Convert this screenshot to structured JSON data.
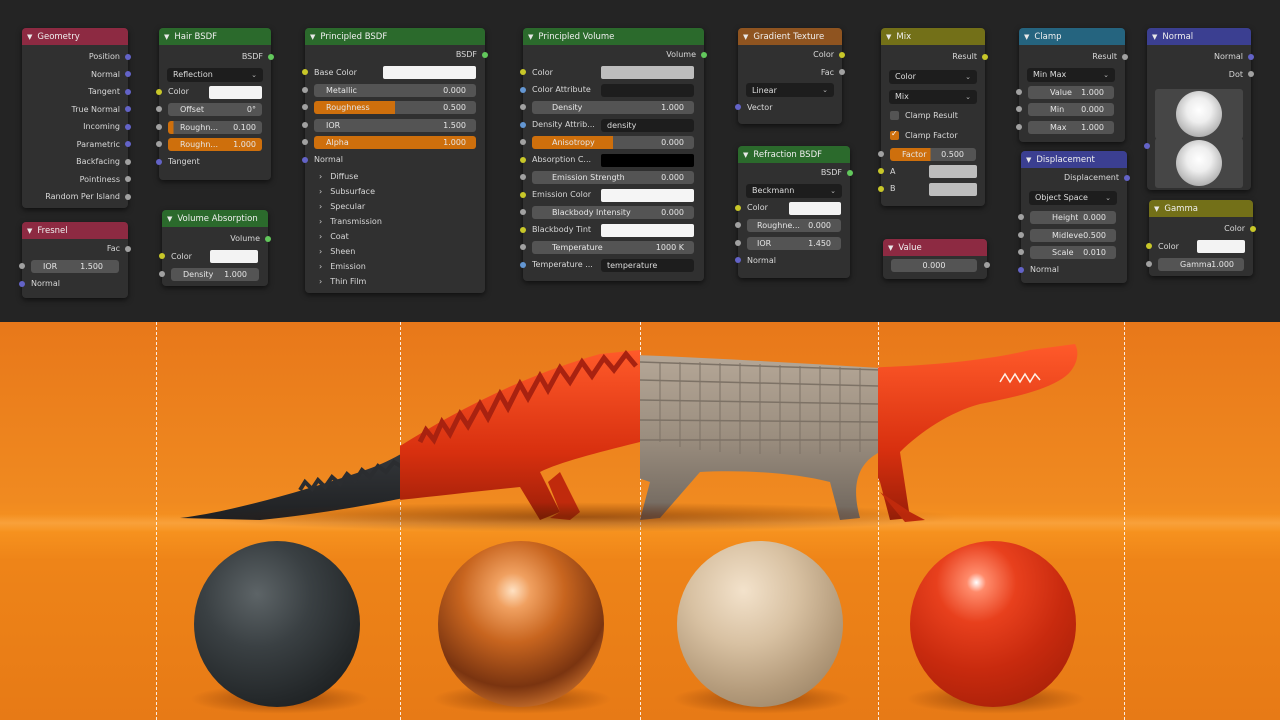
{
  "nodes": {
    "geometry": {
      "title": "Geometry",
      "outputs": [
        "Position",
        "Normal",
        "Tangent",
        "True Normal",
        "Incoming",
        "Parametric",
        "Backfacing",
        "Pointiness",
        "Random Per Island"
      ]
    },
    "fresnel": {
      "title": "Fresnel",
      "out": "Fac",
      "ior_label": "IOR",
      "ior_value": "1.500",
      "normal": "Normal"
    },
    "hair_bsdf": {
      "title": "Hair BSDF",
      "out": "BSDF",
      "dropdown": "Reflection",
      "color": "Color",
      "offset_label": "Offset",
      "offset_value": "0°",
      "rough1_label": "Roughn...",
      "rough1_value": "0.100",
      "rough2_label": "Roughn...",
      "rough2_value": "1.000",
      "tangent": "Tangent"
    },
    "volume_absorption": {
      "title": "Volume Absorption",
      "out": "Volume",
      "color": "Color",
      "density_label": "Density",
      "density_value": "1.000"
    },
    "principled_bsdf": {
      "title": "Principled BSDF",
      "out": "BSDF",
      "base_color": "Base Color",
      "metallic_label": "Metallic",
      "metallic_value": "0.000",
      "roughness_label": "Roughness",
      "roughness_value": "0.500",
      "ior_label": "IOR",
      "ior_value": "1.500",
      "alpha_label": "Alpha",
      "alpha_value": "1.000",
      "normal": "Normal",
      "panels": [
        "Diffuse",
        "Subsurface",
        "Specular",
        "Transmission",
        "Coat",
        "Sheen",
        "Emission",
        "Thin Film"
      ]
    },
    "principled_volume": {
      "title": "Principled Volume",
      "out": "Volume",
      "color": "Color",
      "color_attribute": "Color Attribute",
      "density_label": "Density",
      "density_value": "1.000",
      "density_attrib_label": "Density Attrib...",
      "density_attrib_value": "density",
      "anisotropy_label": "Anisotropy",
      "anisotropy_value": "0.000",
      "absorption_label": "Absorption C...",
      "emission_strength_label": "Emission Strength",
      "emission_strength_value": "0.000",
      "emission_color_label": "Emission Color",
      "blackbody_intensity_label": "Blackbody Intensity",
      "blackbody_intensity_value": "0.000",
      "blackbody_tint_label": "Blackbody Tint",
      "temperature_label": "Temperature",
      "temperature_value": "1000 K",
      "temperature_attr_label": "Temperature ...",
      "temperature_attr_value": "temperature"
    },
    "gradient_texture": {
      "title": "Gradient Texture",
      "out_color": "Color",
      "out_fac": "Fac",
      "dropdown": "Linear",
      "vector": "Vector"
    },
    "refraction_bsdf": {
      "title": "Refraction BSDF",
      "out": "BSDF",
      "dropdown": "Beckmann",
      "color": "Color",
      "rough_label": "Roughne...",
      "rough_value": "0.000",
      "ior_label": "IOR",
      "ior_value": "1.450",
      "normal": "Normal"
    },
    "mix": {
      "title": "Mix",
      "out": "Result",
      "dropdown1": "Color",
      "dropdown2": "Mix",
      "clamp_result": "Clamp Result",
      "clamp_factor": "Clamp Factor",
      "factor_label": "Factor",
      "factor_value": "0.500",
      "a": "A",
      "b": "B"
    },
    "value": {
      "title": "Value",
      "value": "0.000"
    },
    "clamp": {
      "title": "Clamp",
      "out": "Result",
      "dropdown": "Min Max",
      "value_label": "Value",
      "value_value": "1.000",
      "min_label": "Min",
      "min_value": "0.000",
      "max_label": "Max",
      "max_value": "1.000"
    },
    "displacement": {
      "title": "Displacement",
      "out": "Displacement",
      "dropdown": "Object Space",
      "height_label": "Height",
      "height_value": "0.000",
      "midlevel_label": "Midlevel",
      "midlevel_value": "0.500",
      "scale_label": "Scale",
      "scale_value": "0.010",
      "normal": "Normal"
    },
    "normal": {
      "title": "Normal",
      "out_normal": "Normal",
      "out_dot": "Dot"
    },
    "gamma": {
      "title": "Gamma",
      "out": "Color",
      "color": "Color",
      "gamma_label": "Gamma",
      "gamma_value": "1.000"
    }
  },
  "colors": {
    "orange_accent": "#ce6f0c",
    "node_bg": "#303030",
    "editor_bg": "#242424",
    "render_bg": "#f08a20"
  },
  "render": {
    "spheres": [
      "dark-rough",
      "copper-metal",
      "wood",
      "red-glossy"
    ],
    "subject": "crocodile"
  }
}
